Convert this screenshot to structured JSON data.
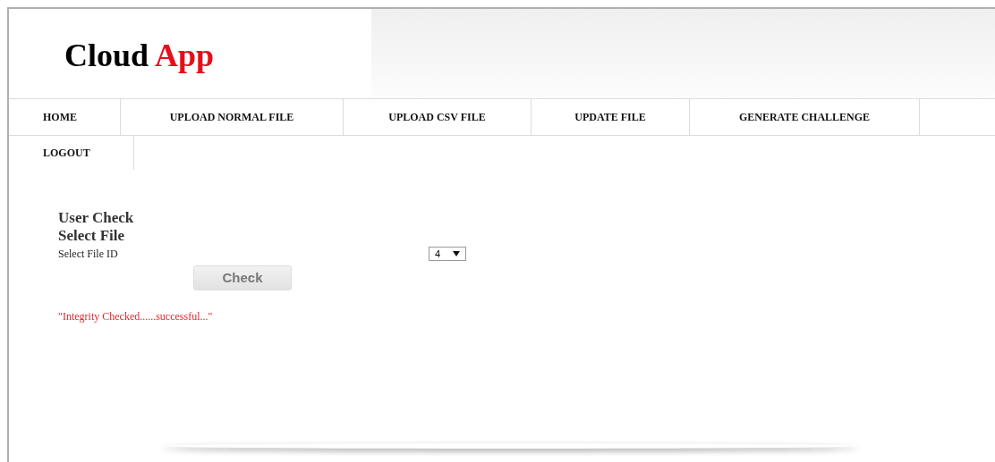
{
  "logo": {
    "main": "Cloud",
    "accent": "App"
  },
  "nav": [
    {
      "label": "HOME"
    },
    {
      "label": "UPLOAD NORMAL FILE"
    },
    {
      "label": "UPLOAD CSV FILE"
    },
    {
      "label": "UPDATE FILE"
    },
    {
      "label": "GENERATE CHALLENGE"
    },
    {
      "label": "LOGOUT"
    }
  ],
  "form": {
    "title": "User Check",
    "subtitle": "Select File",
    "field_label": "Select File ID",
    "select_value": "4",
    "button": "Check"
  },
  "message": "\"Integrity Checked......successful...\""
}
